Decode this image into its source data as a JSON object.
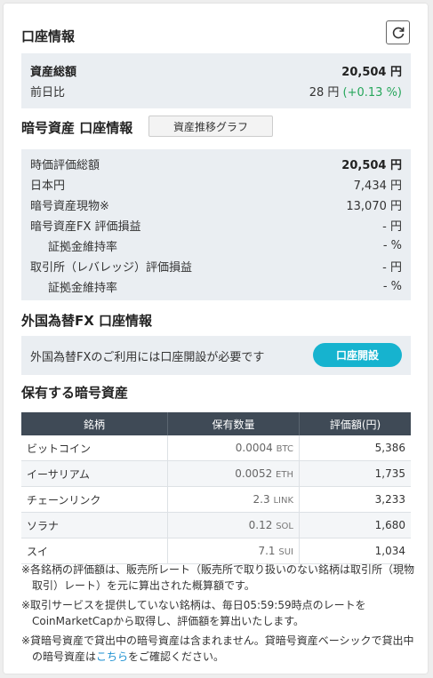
{
  "header": {
    "title": "口座情報"
  },
  "summary": {
    "total_label": "資産総額",
    "total_value": "20,504 円",
    "change_label": "前日比",
    "change_value": "28 円",
    "change_pct": "(+0.13 %)"
  },
  "crypto": {
    "title": "暗号資産 口座情報",
    "graph_button": "資産推移グラフ",
    "rows": [
      {
        "label": "時価評価総額",
        "value": "20,504 円"
      },
      {
        "label": "日本円",
        "value": "7,434 円"
      },
      {
        "label": "暗号資産現物※",
        "value": "13,070 円"
      },
      {
        "label": "暗号資産FX 評価損益",
        "value": "- 円"
      },
      {
        "label": "証拠金維持率",
        "value": "- %"
      },
      {
        "label": "取引所（レバレッジ）評価損益",
        "value": "- 円"
      },
      {
        "label": "証拠金維持率",
        "value": "- %"
      }
    ]
  },
  "fx": {
    "title": "外国為替FX 口座情報",
    "message": "外国為替FXのご利用には口座開設が必要です",
    "open_button": "口座開設"
  },
  "holdings": {
    "title": "保有する暗号資産",
    "columns": [
      "銘柄",
      "保有数量",
      "評価額(円)"
    ],
    "rows": [
      {
        "name": "ビットコイン",
        "qty": "0.0004",
        "unit": "BTC",
        "value": "5,386"
      },
      {
        "name": "イーサリアム",
        "qty": "0.0052",
        "unit": "ETH",
        "value": "1,735"
      },
      {
        "name": "チェーンリンク",
        "qty": "2.3",
        "unit": "LINK",
        "value": "3,233"
      },
      {
        "name": "ソラナ",
        "qty": "0.12",
        "unit": "SOL",
        "value": "1,680"
      },
      {
        "name": "スイ",
        "qty": "7.1",
        "unit": "SUI",
        "value": "1,034"
      }
    ]
  },
  "notes": {
    "note1": "※各銘柄の評価額は、販売所レート（販売所で取り扱いのない銘柄は取引所（現物取引）レート）を元に算出された概算額です。",
    "note2": "※取引サービスを提供していない銘柄は、毎日05:59:59時点のレートをCoinMarketCapから取得し、評価額を算出いたします。",
    "note3_prefix": "※貸暗号資産で貸出中の暗号資産は含まれません。貸暗号資産ベーシックで貸出中の暗号資産は",
    "note3_link": "こちら",
    "note3_suffix": "をご確認ください。"
  },
  "colors": {
    "accent": "#16b3cf",
    "positive": "#26a65b",
    "table_header": "#3f4a56",
    "panel": "#eaeef2",
    "link": "#1a8fd0"
  },
  "icons": {
    "refresh": "refresh-icon"
  }
}
